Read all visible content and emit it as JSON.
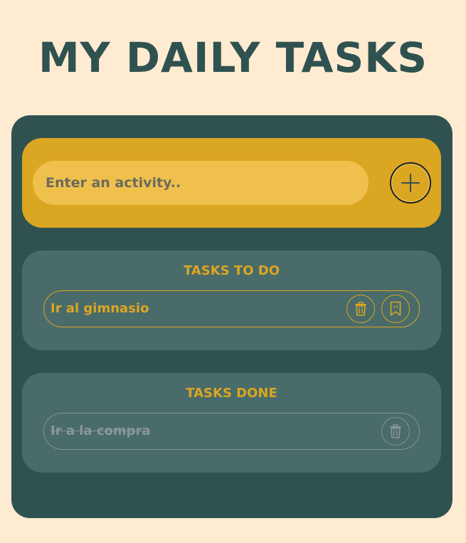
{
  "app": {
    "title": "MY DAILY TASKS"
  },
  "input": {
    "placeholder": "Enter an activity.."
  },
  "add_button": {
    "icon": "plus-icon"
  },
  "todo": {
    "heading": "TASKS TO DO",
    "items": [
      {
        "text": "Ir al gimnasio",
        "icons": [
          "trash-icon",
          "bookmark-icon"
        ]
      }
    ]
  },
  "done": {
    "heading": "TASKS DONE",
    "items": [
      {
        "text": "Ir a la compra",
        "icons": [
          "trash-icon"
        ]
      }
    ]
  },
  "colors": {
    "background": "#ffebd1",
    "card": "#2f5250",
    "accent": "#dba622",
    "input_fill": "#f0c04d",
    "section": "#496b6a",
    "done_text": "#8a9797"
  }
}
